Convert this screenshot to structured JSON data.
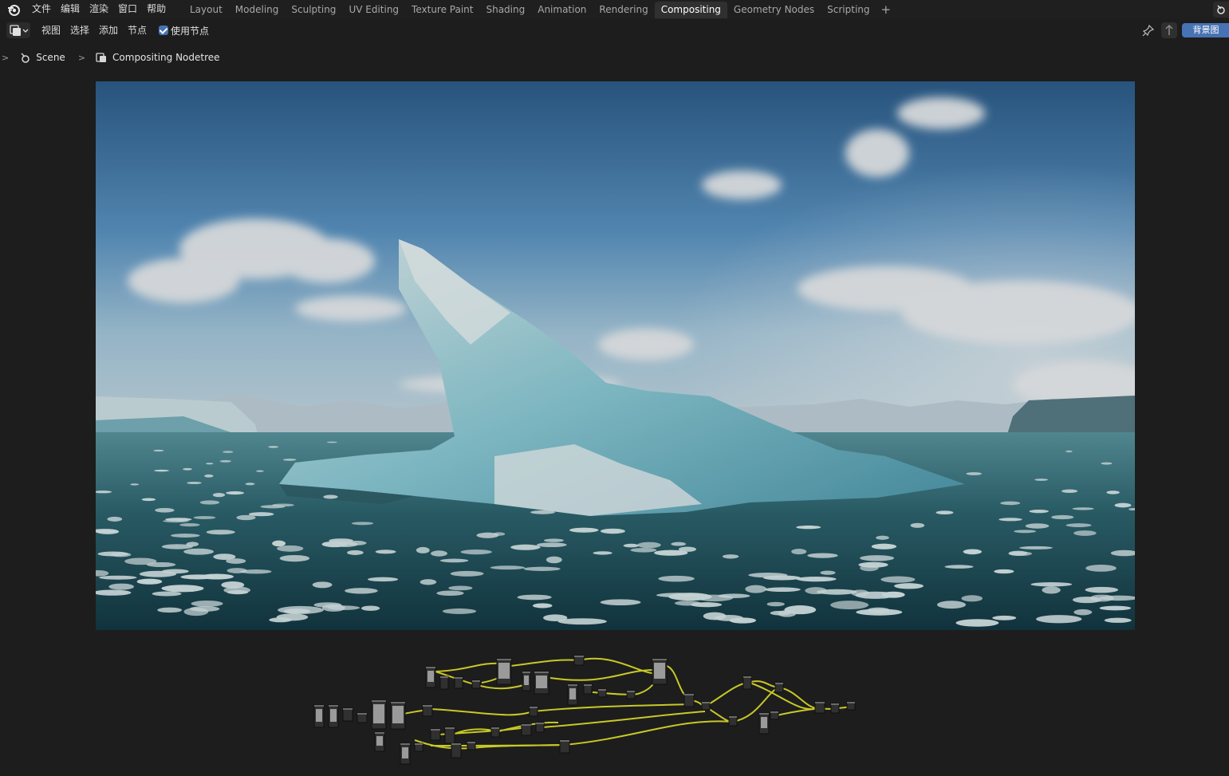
{
  "menu": {
    "items": [
      "文件",
      "编辑",
      "渲染",
      "窗口",
      "帮助"
    ]
  },
  "workspaces": {
    "tabs": [
      "Layout",
      "Modeling",
      "Sculpting",
      "UV Editing",
      "Texture Paint",
      "Shading",
      "Animation",
      "Rendering",
      "Compositing",
      "Geometry Nodes",
      "Scripting"
    ],
    "active": "Compositing",
    "add_label": "+"
  },
  "editor_header": {
    "menus": [
      "视图",
      "选择",
      "添加",
      "节点"
    ],
    "use_nodes_label": "使用节点",
    "use_nodes_checked": true,
    "backdrop_label": "背景图"
  },
  "breadcrumb": {
    "scene": "Scene",
    "nodetree": "Compositing Nodetree"
  },
  "colors": {
    "accent": "#4772b3",
    "active_tab_bg": "#303030",
    "noodle": "#c8c828"
  },
  "icons": {
    "logo": "blender-logo-icon",
    "scene": "scene-icon",
    "nodetree": "node-tree-icon",
    "pin": "pin-icon",
    "parent": "parent-node-tree-icon",
    "editor_type": "node-editor-icon"
  }
}
